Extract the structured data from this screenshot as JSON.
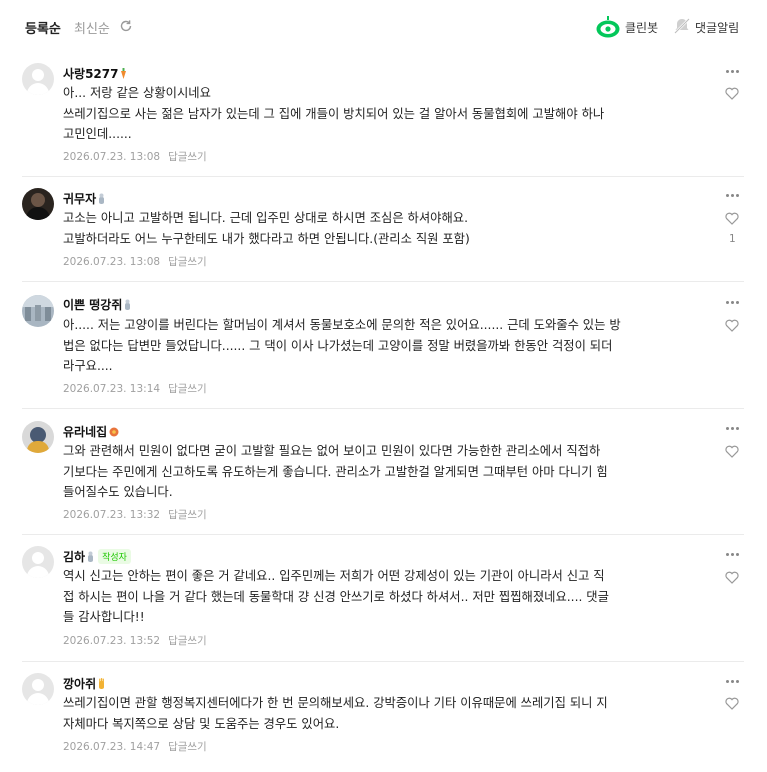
{
  "sort": {
    "active": "등록순",
    "inactive": "최신순"
  },
  "toolbar": {
    "cleanbot_label": "클린봇",
    "notify_label": "댓글알림"
  },
  "comments": [
    {
      "nickname": "사랑5277",
      "level_icon": "carrot-level-icon",
      "text": "아... 저랑 같은 상황이시네요\n쓰레기집으로 사는 젊은 남자가 있는데 그 집에 개들이 방치되어 있는 걸 알아서 동물협회에 고발해야 하나\n고민인데......",
      "date": "2026.07.23. 13:08",
      "reply": "답글쓰기",
      "likes": null
    },
    {
      "nickname": "귀무자",
      "level_icon": "sprout-level-icon",
      "text": "고소는 아니고 고발하면 됩니다. 근데 입주민 상대로 하시면 조심은 하셔야해요.\n고발하더라도 어느 누구한테도 내가 했다라고 하면 안됩니다.(관리소 직원 포함)",
      "date": "2026.07.23. 13:08",
      "reply": "답글쓰기",
      "likes": "1"
    },
    {
      "nickname": "이쁜 떵강쥐",
      "level_icon": "sprout-level-icon",
      "text": "아..... 저는 고양이를 버린다는 할머님이 계셔서 동물보호소에 문의한 적은 있어요...... 근데 도와줄수 있는 방\n법은 없다는 답변만 들었답니다...... 그 댁이 이사 나가셨는데 고양이를 정말 버렸을까봐 한동안 걱정이 되더\n라구요....",
      "date": "2026.07.23. 13:14",
      "reply": "답글쓰기",
      "likes": null
    },
    {
      "nickname": "유라네집",
      "level_icon": "flower-level-icon",
      "text": "그와 관련해서 민원이 없다면 굳이 고발할 필요는 없어 보이고 민원이 있다면 가능한한 관리소에서 직접하\n기보다는 주민에게 신고하도록 유도하는게 좋습니다. 관리소가 고발한걸 알게되면 그때부턴 아마 다니기 힘\n들어질수도 있습니다.",
      "date": "2026.07.23. 13:32",
      "reply": "답글쓰기",
      "likes": null
    },
    {
      "nickname": "김하",
      "level_icon": "sprout-level-icon",
      "badge": "작성자",
      "text": "역시 신고는 안하는 편이 좋은 거 같네요.. 입주민께는 저희가 어떤 강제성이 있는 기관이 아니라서 신고 직\n접 하시는 편이 나을 거 같다 했는데 동물학대 걍 신경 안쓰기로 하셨다 하셔서.. 저만 찝찝해졌네요.... 댓글\n들 감사합니다!!",
      "date": "2026.07.23. 13:52",
      "reply": "답글쓰기",
      "likes": null
    },
    {
      "nickname": "깡아쥐",
      "level_icon": "hand-level-icon",
      "text": "쓰레기집이면 관할 행정복지센터에다가 한 번 문의해보세요. 강박증이나 기타 이유때문에 쓰레기집 되니 지\n자체마다 복지쪽으로 상담 및 도움주는 경우도 있어요.",
      "date": "2026.07.23. 14:47",
      "reply": "답글쓰기",
      "likes": null
    }
  ]
}
